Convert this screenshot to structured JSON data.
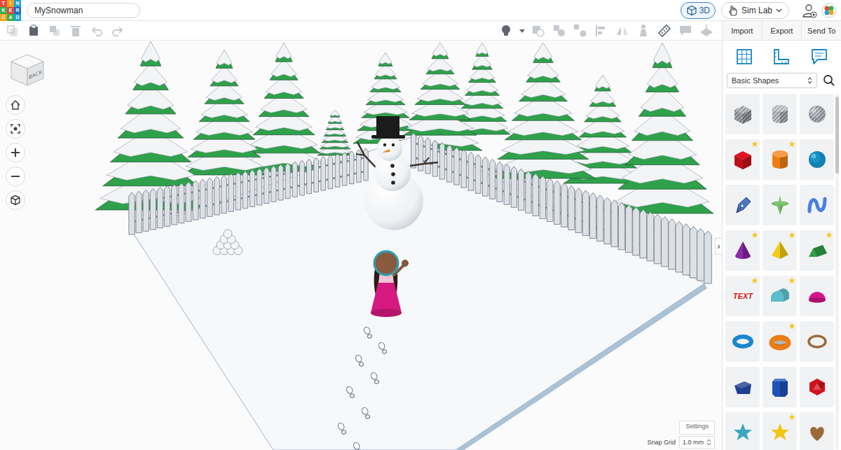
{
  "app": {
    "logo": [
      {
        "letter": "T",
        "color": "#e8473d"
      },
      {
        "letter": "I",
        "color": "#f4a21c"
      },
      {
        "letter": "N",
        "color": "#1fa1dd"
      },
      {
        "letter": "K",
        "color": "#36b24a"
      },
      {
        "letter": "E",
        "color": "#e8473d"
      },
      {
        "letter": "R",
        "color": "#1c6cc4"
      },
      {
        "letter": "C",
        "color": "#f4a21c"
      },
      {
        "letter": "A",
        "color": "#36b24a"
      },
      {
        "letter": "D",
        "color": "#1fa1dd"
      }
    ],
    "title": "MySnowman"
  },
  "header": {
    "modeButton": {
      "label": "3D",
      "selected": true
    },
    "simLab": {
      "label": "Sim Lab"
    }
  },
  "toolbar": {
    "edit": [
      {
        "kind": "copy",
        "disabled": true
      },
      {
        "kind": "paste",
        "disabled": false
      },
      {
        "kind": "duplicate",
        "disabled": true
      },
      {
        "kind": "delete",
        "disabled": true
      },
      {
        "kind": "undo",
        "disabled": true
      },
      {
        "kind": "redo",
        "disabled": true
      }
    ],
    "tools": [
      {
        "kind": "bulb",
        "disabled": false
      },
      {
        "kind": "caret",
        "disabled": false
      },
      {
        "kind": "hole",
        "disabled": true
      },
      {
        "kind": "group",
        "disabled": true
      },
      {
        "kind": "ungroup",
        "disabled": true
      },
      {
        "kind": "align",
        "disabled": true
      },
      {
        "kind": "mirror",
        "disabled": true
      },
      {
        "kind": "cruise",
        "disabled": true
      },
      {
        "kind": "ruler",
        "disabled": false
      },
      {
        "kind": "notes",
        "disabled": true
      },
      {
        "kind": "workplane",
        "disabled": true
      }
    ],
    "actions": [
      {
        "label": "Import"
      },
      {
        "label": "Export"
      },
      {
        "label": "Send To"
      }
    ]
  },
  "viewCube": {
    "face": "BACK"
  },
  "canvas": {
    "collapse": "›",
    "settings": "Settings",
    "snapGrid": {
      "label": "Snap Grid",
      "value": "1.0 mm"
    }
  },
  "panel": {
    "category": "Basic Shapes",
    "shapes": [
      {
        "kind": "box",
        "color": "#9aa0a6",
        "hole": true,
        "starred": false
      },
      {
        "kind": "cylinder",
        "color": "#9aa0a6",
        "hole": true,
        "starred": false
      },
      {
        "kind": "sphere",
        "color": "#9aa0a6",
        "hole": true,
        "starred": false
      },
      {
        "kind": "box",
        "color": "#e0121d",
        "hole": false,
        "starred": true
      },
      {
        "kind": "cylinder",
        "color": "#ef7d12",
        "hole": false,
        "starred": true
      },
      {
        "kind": "sphere",
        "color": "#1592c9",
        "hole": false,
        "starred": false
      },
      {
        "kind": "scribble",
        "color": "#4a78c4",
        "hole": false,
        "starred": false
      },
      {
        "kind": "paraboloid",
        "color": "#7cc46a",
        "hole": false,
        "starred": false
      },
      {
        "kind": "shapegen",
        "color": "#4a7fe0",
        "hole": false,
        "starred": false
      },
      {
        "kind": "cone",
        "color": "#8a2aa8",
        "hole": false,
        "starred": true
      },
      {
        "kind": "pyramid",
        "color": "#f2cc16",
        "hole": false,
        "starred": true
      },
      {
        "kind": "roof",
        "color": "#2ea043",
        "hole": false,
        "starred": true
      },
      {
        "kind": "text",
        "color": "#d01920",
        "hole": false,
        "starred": true,
        "label": "TEXT"
      },
      {
        "kind": "roundroof",
        "color": "#5bbccc",
        "hole": false,
        "starred": true
      },
      {
        "kind": "halfsphere",
        "color": "#d3168a",
        "hole": false,
        "starred": false
      },
      {
        "kind": "torus",
        "color": "#1a86d0",
        "hole": false,
        "starred": false
      },
      {
        "kind": "tube",
        "color": "#ec7d14",
        "hole": false,
        "starred": true
      },
      {
        "kind": "ring",
        "color": "#9a6a3c",
        "hole": false,
        "starred": false
      },
      {
        "kind": "polygon",
        "color": "#1f3f8f",
        "hole": false,
        "starred": false
      },
      {
        "kind": "prism",
        "color": "#1e52b8",
        "hole": false,
        "starred": false
      },
      {
        "kind": "polyhedron",
        "color": "#d0121c",
        "hole": false,
        "starred": false
      },
      {
        "kind": "star",
        "color": "#3aa6c0",
        "hole": false,
        "starred": false
      },
      {
        "kind": "star",
        "color": "#f2c416",
        "hole": false,
        "starred": true
      },
      {
        "kind": "heart",
        "color": "#9a6a3c",
        "hole": false,
        "starred": false
      }
    ]
  }
}
